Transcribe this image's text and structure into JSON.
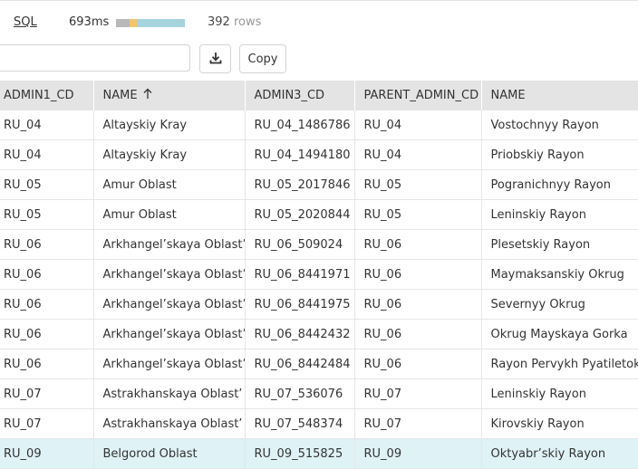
{
  "status": {
    "sql_label": "SQL",
    "time": "693ms",
    "timing_segments": [
      0.2,
      0.1,
      0.7
    ],
    "row_count": "392",
    "row_unit": "rows"
  },
  "toolbar": {
    "search_value": "",
    "copy_label": "Copy",
    "download_icon": "download-icon"
  },
  "table": {
    "columns": [
      "ADMIN1_CD",
      "NAME",
      "ADMIN3_CD",
      "PARENT_ADMIN_CD",
      "NAME"
    ],
    "sorted_column": 1,
    "sort_direction": "ascending",
    "rows": [
      [
        "RU_04",
        "Altayskiy Kray",
        "RU_04_1486786",
        "RU_04",
        "Vostochnyy Rayon"
      ],
      [
        "RU_04",
        "Altayskiy Kray",
        "RU_04_1494180",
        "RU_04",
        "Priobskiy Rayon"
      ],
      [
        "RU_05",
        "Amur Oblast",
        "RU_05_2017846",
        "RU_05",
        "Pogranichnyy Rayon"
      ],
      [
        "RU_05",
        "Amur Oblast",
        "RU_05_2020844",
        "RU_05",
        "Leninskiy Rayon"
      ],
      [
        "RU_06",
        "Arkhangel’skaya Oblast’",
        "RU_06_509024",
        "RU_06",
        "Plesetskiy Rayon"
      ],
      [
        "RU_06",
        "Arkhangel’skaya Oblast’",
        "RU_06_8441971",
        "RU_06",
        "Maymaksanskiy Okrug"
      ],
      [
        "RU_06",
        "Arkhangel’skaya Oblast’",
        "RU_06_8441975",
        "RU_06",
        "Severnyy Okrug"
      ],
      [
        "RU_06",
        "Arkhangel’skaya Oblast’",
        "RU_06_8442432",
        "RU_06",
        "Okrug Mayskaya Gorka"
      ],
      [
        "RU_06",
        "Arkhangel’skaya Oblast’",
        "RU_06_8442484",
        "RU_06",
        "Rayon Pervykh Pyatiletok"
      ],
      [
        "RU_07",
        "Astrakhanskaya Oblast’",
        "RU_07_536076",
        "RU_07",
        "Leninskiy Rayon"
      ],
      [
        "RU_07",
        "Astrakhanskaya Oblast’",
        "RU_07_548374",
        "RU_07",
        "Kirovskiy Rayon"
      ],
      [
        "RU_09",
        "Belgorod Oblast",
        "RU_09_515825",
        "RU_09",
        "Oktyabr’skiy Rayon"
      ]
    ],
    "selected_row": 11
  },
  "colors": {
    "header_bg": "#e4e4e4",
    "selected_row_bg": "#dff2f6",
    "timing_1": "#b9b9b9",
    "timing_2": "#f3c56e",
    "timing_3": "#a6d4de"
  }
}
